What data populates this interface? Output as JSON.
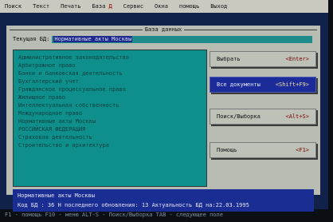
{
  "menu": [
    "Поиск",
    "Текст",
    "Печать",
    "База",
    "Сервис",
    "Окна",
    "помощь",
    "Выход"
  ],
  "menu_hotkeys": [
    "",
    "",
    "",
    "Д",
    "",
    "",
    "",
    ""
  ],
  "window": {
    "title": "База данных"
  },
  "current_db": {
    "label": "Текущая БД:",
    "value": "Нормативные акты Москвы"
  },
  "list_items": [
    "Административное законодательство",
    "Арбитражное право",
    "Банки и банковская деятельность",
    "Бухгалтерский учет",
    "Гражданское процессуальное право",
    "Жилищное право",
    "Интеллектуальная собственность",
    "Международное право",
    "Нормативные акты Москвы",
    "РОССИЙСКАЯ ФЕДЕРАЦИЯ",
    "Страховая деятельность",
    "Строительство и архитектура"
  ],
  "buttons": [
    {
      "label": "Выбрать",
      "key": "<Enter>",
      "active": false
    },
    {
      "label": "Все документы",
      "key": "<Shift+F9>",
      "active": true
    },
    {
      "label": "Поиск/Выборка",
      "key": "<Alt+S>",
      "active": false
    },
    {
      "label": "Помощь",
      "key": "<F1>",
      "active": false
    }
  ],
  "status": {
    "name": "Нормативные акты Москвы",
    "info": "Код БД : 36 Н последнего обновления: 13 Актуальность БД на:22.03.1995"
  },
  "hint_bar": "F1 - помощь  F10 - меню  ALT-S - Поиск/Выборка  TAB - следующее поле"
}
